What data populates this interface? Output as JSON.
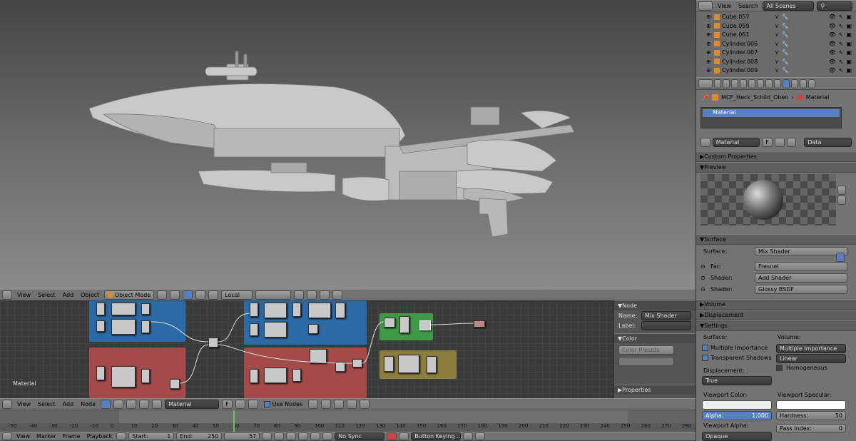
{
  "outliner": {
    "header": {
      "view": "View",
      "search": "Search",
      "scene_filter": "All Scenes"
    },
    "items": [
      {
        "name": "Cube.057"
      },
      {
        "name": "Cube.059"
      },
      {
        "name": "Cube.061"
      },
      {
        "name": "Cylinder.006"
      },
      {
        "name": "Cylinder.007"
      },
      {
        "name": "Cylinder.008"
      },
      {
        "name": "Cylinder.009"
      }
    ]
  },
  "properties": {
    "breadcrumb": {
      "object": "MCF_Heck_Schild_Oben",
      "material": "Material"
    },
    "slot": "Material",
    "material_name": "Material",
    "fake_user": "F",
    "link": "Data",
    "sections": {
      "custom": "Custom Properties",
      "preview": "Preview",
      "surface": "Surface",
      "volume": "Volume",
      "displacement": "Displacement",
      "settings": "Settings"
    },
    "surface": {
      "surface_label": "Surface:",
      "surface_value": "Mix Shader",
      "fac_label": "Fac:",
      "fac_value": "Fresnel",
      "shader1_label": "Shader:",
      "shader1_value": "Add Shader",
      "shader2_label": "Shader:",
      "shader2_value": "Glossy BSDF"
    },
    "settings": {
      "surface_label": "Surface:",
      "volume_label": "Volume:",
      "multiple_importance": "Multiple Importance",
      "transparent_shadows": "Transparent Shadows",
      "volume_value": "Multiple Importance",
      "interp": "Linear",
      "homogeneous": "Homogeneous",
      "displacement_label": "Displacement:",
      "displacement_value": "True",
      "viewport_color": "Viewport Color:",
      "viewport_specular": "Viewport Specular:",
      "alpha_label": "Alpha:",
      "alpha_value": "1.000",
      "hardness_label": "Hardness:",
      "hardness_value": "50",
      "viewport_alpha": "Viewport Alpha:",
      "viewport_alpha_value": "Opaque",
      "pass_label": "Pass Index:",
      "pass_value": "0"
    }
  },
  "viewport_header": {
    "view": "View",
    "select": "Select",
    "add": "Add",
    "object": "Object",
    "mode": "Object Mode",
    "orientation": "Local"
  },
  "node_editor": {
    "label": "Material",
    "panel": {
      "node_title": "Node",
      "name_label": "Name:",
      "name_value": "Mix Shader",
      "label_label": "Label:",
      "color": "Color",
      "color_presets": "Color Presets",
      "properties": "Properties"
    },
    "header": {
      "view": "View",
      "select": "Select",
      "add": "Add",
      "node": "Node",
      "material": "Material",
      "fake": "F",
      "use_nodes": "Use Nodes"
    }
  },
  "timeline": {
    "ticks": [
      "-50",
      "-40",
      "-30",
      "-20",
      "-10",
      "0",
      "10",
      "20",
      "30",
      "40",
      "50",
      "60",
      "70",
      "80",
      "90",
      "100",
      "110",
      "120",
      "130",
      "140",
      "150",
      "160",
      "170",
      "180",
      "190",
      "200",
      "210",
      "220",
      "230",
      "240",
      "250",
      "260",
      "270",
      "280"
    ],
    "current_frame_marker": 57,
    "header": {
      "view": "View",
      "marker": "Marker",
      "frame": "Frame",
      "playback": "Playback",
      "start_label": "Start:",
      "start": "1",
      "end_label": "End:",
      "end": "250",
      "current": "57",
      "sync": "No Sync",
      "keying": "Button Keying ..."
    }
  }
}
